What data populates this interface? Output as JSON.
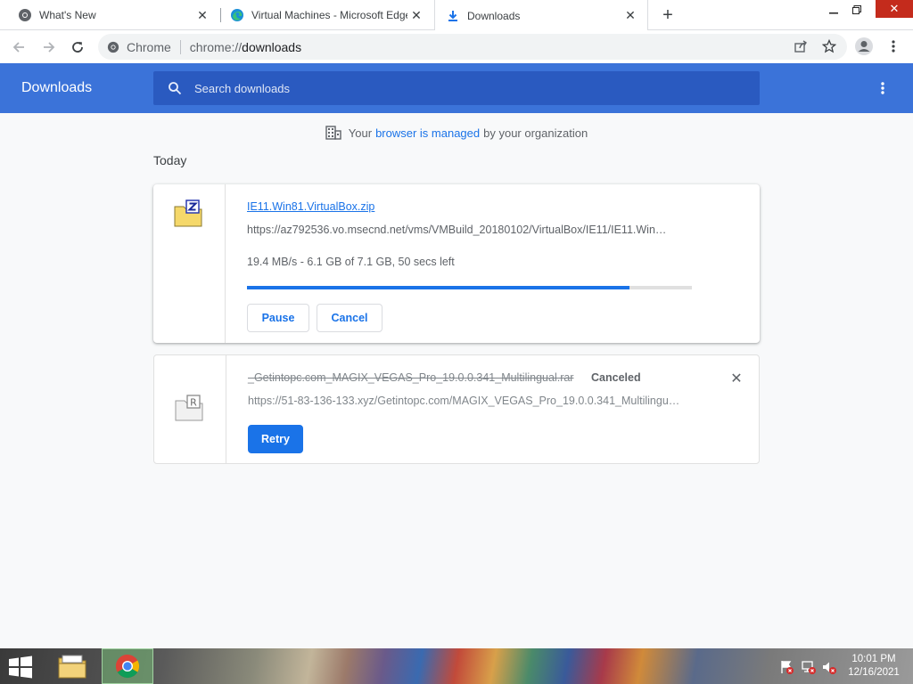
{
  "browser": {
    "tabs": [
      {
        "title": "What's New",
        "icon": "chrome-icon"
      },
      {
        "title": "Virtual Machines - Microsoft Edge",
        "icon": "edge-icon"
      },
      {
        "title": "Downloads",
        "icon": "download-icon",
        "active": true
      }
    ],
    "new_tab_label": "+",
    "omnibox": {
      "chip_label": "Chrome",
      "url_scheme": "chrome://",
      "url_host": "downloads"
    }
  },
  "downloads_page": {
    "title": "Downloads",
    "search_placeholder": "Search downloads",
    "managed_notice": {
      "before": "Your",
      "link": "browser is managed",
      "after": "by your organization"
    },
    "section_title": "Today",
    "items": [
      {
        "file_name": "IE11.Win81.VirtualBox.zip",
        "url": "https://az792536.vo.msecnd.net/vms/VMBuild_20180102/VirtualBox/IE11/IE11.Win…",
        "progress_text": "19.4 MB/s - 6.1 GB of 7.1 GB, 50 secs left",
        "progress_fraction": 0.86,
        "icon": "zip-file-icon",
        "actions": {
          "pause": "Pause",
          "cancel": "Cancel"
        }
      },
      {
        "file_name": "_Getintopc.com_MAGIX_VEGAS_Pro_19.0.0.341_Multilingual.rar",
        "status": "Canceled",
        "url": "https://51-83-136-133.xyz/Getintopc.com/MAGIX_VEGAS_Pro_19.0.0.341_Multilingu…",
        "icon": "rar-file-icon",
        "actions": {
          "retry": "Retry"
        }
      }
    ]
  },
  "colors": {
    "header_blue": "#3b73d9",
    "search_blue": "#2a5ac0",
    "accent": "#1a73e8"
  },
  "taskbar": {
    "clock_time": "10:01 PM",
    "clock_date": "12/16/2021",
    "apps": [
      "file-explorer-icon",
      "chrome-icon"
    ]
  }
}
